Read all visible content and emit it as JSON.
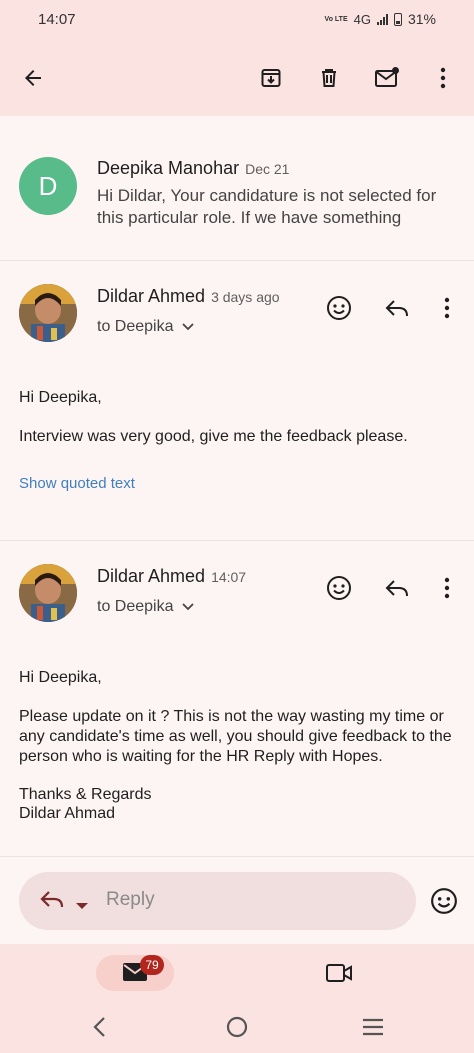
{
  "status_bar": {
    "time": "14:07",
    "network": "4G",
    "volte_label": "Vo LTE",
    "battery": "31%"
  },
  "toolbar": {
    "icons": [
      "back-arrow-icon",
      "archive-icon",
      "delete-icon",
      "mark-unread-icon",
      "more-options-icon"
    ]
  },
  "thread": {
    "collapsed_message": {
      "avatar_letter": "D",
      "avatar_color": "#57bb8a",
      "sender": "Deepika Manohar",
      "date": "Dec 21",
      "snippet": "Hi Dildar, Your candidature is not selected for this particular role. If we have something"
    },
    "messages": [
      {
        "sender": "Dildar Ahmed",
        "date": "3 days ago",
        "to": "to Deepika",
        "body": [
          "Hi Deepika,",
          "Interview was very good, give me the feedback please."
        ],
        "show_quoted": "Show quoted text"
      },
      {
        "sender": "Dildar Ahmed",
        "date": "14:07",
        "to": "to Deepika",
        "greeting": "Hi Deepika,",
        "paragraph": "Please update on it ? This is not the way wasting my time or any candidate's time as well, you should give feedback to the person who is waiting for the HR Reply with Hopes.",
        "signoff_1": "Thanks & Regards",
        "signoff_2": "Dildar Ahmad"
      }
    ]
  },
  "reply": {
    "placeholder": "Reply"
  },
  "bottom_nav": {
    "mail_badge": "79"
  },
  "colors": {
    "accent_bar": "#fbe3e1",
    "link": "#3f7fbf",
    "badge": "#b3261e"
  }
}
